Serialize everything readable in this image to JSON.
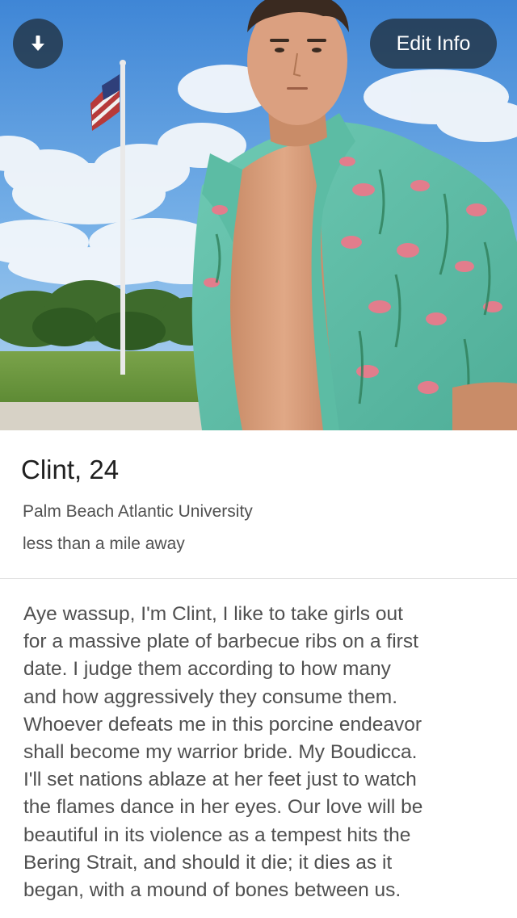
{
  "header": {
    "download_icon": "arrow-down-icon",
    "edit_button_label": "Edit Info"
  },
  "profile": {
    "name_age": "Clint, 24",
    "school": "Palm Beach Atlantic University",
    "distance": "less than a mile away"
  },
  "bio": {
    "lines": [
      "Aye wassup, I'm Clint, I like to take girls out",
      "for a massive plate of barbecue ribs on a first",
      "date. I judge them according to how many",
      "and how aggressively they consume them.",
      "Whoever defeats me in this porcine endeavor",
      "shall become my warrior bride. My Boudicca.",
      "I'll set nations ablaze at her feet just to watch",
      "the flames dance in her eyes. Our love will be",
      "beautiful in its violence as a tempest hits the",
      "Bering Strait, and should it die; it dies as it",
      "began, with a mound of bones between us."
    ]
  },
  "colors": {
    "overlay_button": "#202f3e",
    "text_primary": "#202020",
    "text_secondary": "#505050",
    "divider": "#e3e3e3"
  }
}
